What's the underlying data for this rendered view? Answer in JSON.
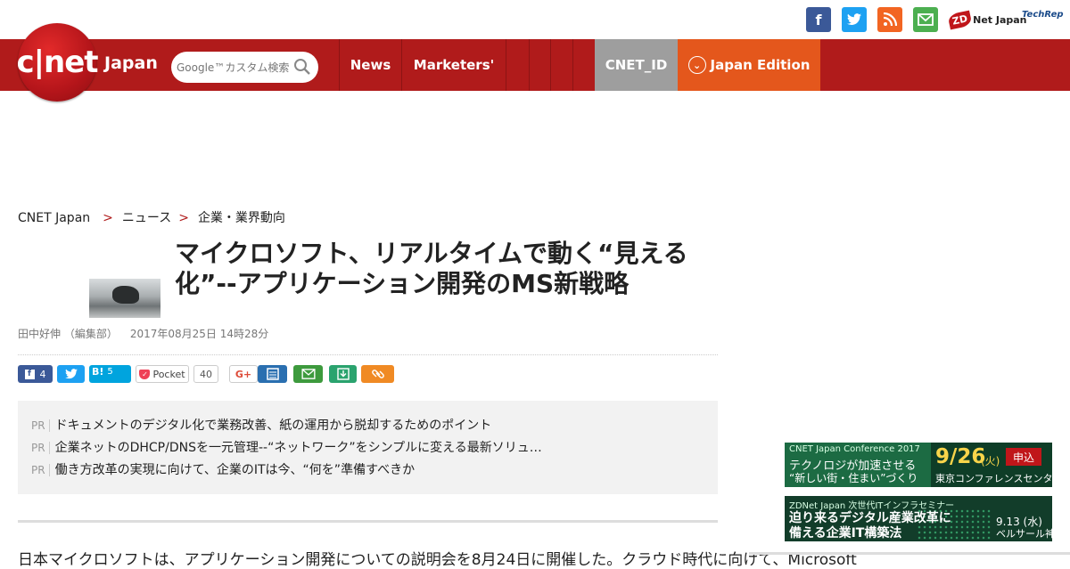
{
  "topbar": {
    "social": [
      {
        "name": "facebook-icon",
        "glyph": "f"
      },
      {
        "name": "twitter-icon",
        "glyph": "t"
      },
      {
        "name": "rss-icon",
        "glyph": "◉"
      },
      {
        "name": "mail-icon",
        "glyph": "✉"
      }
    ],
    "zdnet_label": "ZD",
    "zdnet_text": "Net Japan",
    "techrepublic_text": "TechRep"
  },
  "brand": {
    "logo": "c|net",
    "suffix": "Japan",
    "color": "#b01b1b"
  },
  "search": {
    "placeholder": "Google™カスタム検索"
  },
  "nav": {
    "news": "News",
    "marketers": "Marketers'",
    "cnet_id": "CNET_ID",
    "japan_edition": "Japan Edition"
  },
  "breadcrumb": {
    "home": "CNET Japan",
    "sep1": ">",
    "section": "ニュース",
    "sep2": ">",
    "subsection": "企業・業界動向"
  },
  "article": {
    "title": "マイクロソフト、リアルタイムで動く“見える化”--アプリケーション開発のMS新戦略",
    "author": "田中好伸 （編集部）",
    "date": "2017年08月25日 14時28分"
  },
  "share": {
    "facebook_count": "4",
    "hatena_label": "B!",
    "hatena_count": "5",
    "pocket_label": "Pocket",
    "pocket_count": "40",
    "gplus_label": "G+"
  },
  "pr": {
    "tag": "PR",
    "items": [
      "ドキュメントのデジタル化で業務改善、紙の運用から脱却するためのポイント",
      "企業ネットのDHCP/DNSを一元管理--“ネットワーク”をシンプルに変える最新ソリュ…",
      "働き方改革の実現に向けて、企業のITは今、“何を”準備すべきか"
    ]
  },
  "body": {
    "first_line": "日本マイクロソフトは、アプリケーション開発についての説明会を8月24日に開催した。クラウド時代に向けて、Microsoft"
  },
  "ads": {
    "conf": {
      "sub": "CNET Japan Conference 2017",
      "line1": "テクノロジが加速させる",
      "line2": "“新しい街・住まい”づくり",
      "date": "9/26",
      "dow": "(火)",
      "apply": "申込",
      "venue": "東京コンファレンスセンター"
    },
    "seminar": {
      "sub": "ZDNet Japan  次世代ITインフラセミナー",
      "line1": "迫り来るデジタル産業改革に",
      "line2": "備える企業IT構築法",
      "date": "9.13 (水)",
      "venue": "ベルサール神田"
    }
  }
}
